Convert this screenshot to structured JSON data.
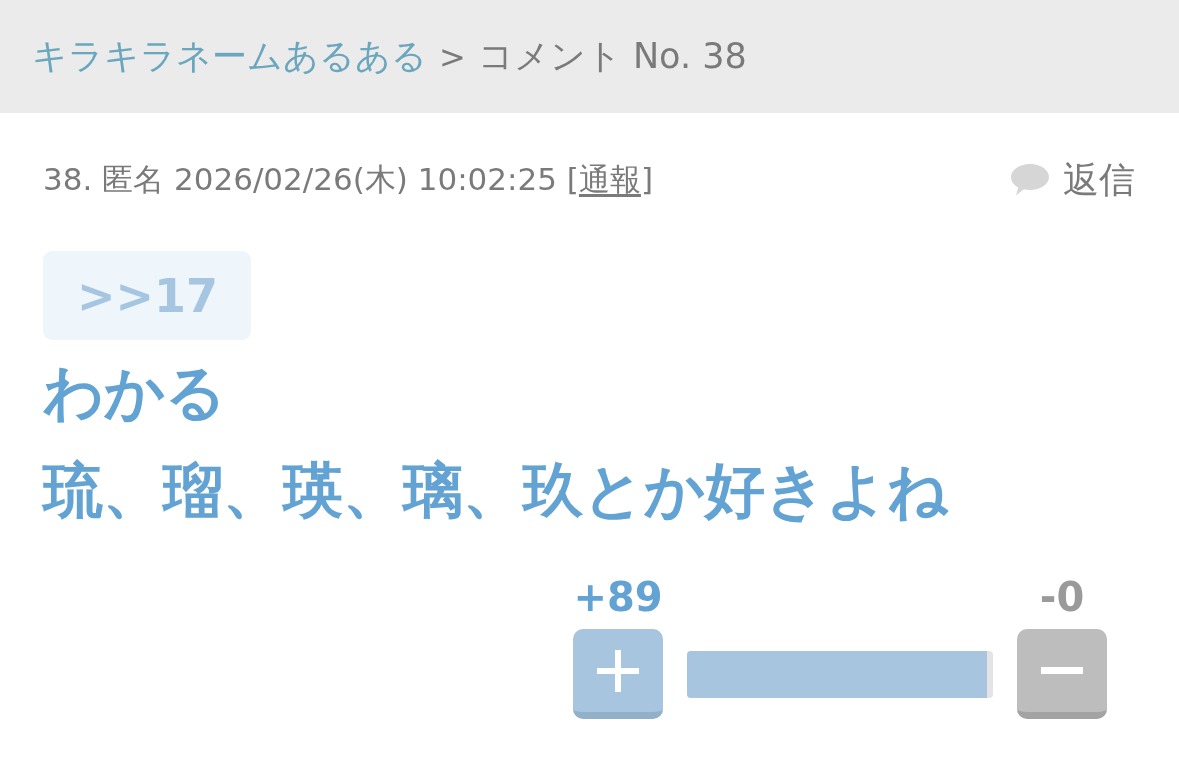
{
  "breadcrumb": {
    "items": [
      {
        "label": "キラキラネームあるある",
        "kind": "link"
      },
      {
        "label": "コメント No. 38",
        "kind": "current"
      }
    ],
    "separator": ">"
  },
  "comment": {
    "number": "38.",
    "author": "匿名",
    "posted_at": "2026/02/26(木) 10:02:25",
    "report": {
      "open": "[",
      "label": "通報",
      "close": "]"
    },
    "reply_button": {
      "label": "返信"
    },
    "quote_anchor": ">>17",
    "body": [
      "わかる",
      "琉、瑠、瑛、璃、玖とか好きよね"
    ],
    "votes": {
      "plus": {
        "count": "+89"
      },
      "minus": {
        "count": "-0"
      },
      "ratio_bar": {
        "level": 0.98
      }
    }
  }
}
